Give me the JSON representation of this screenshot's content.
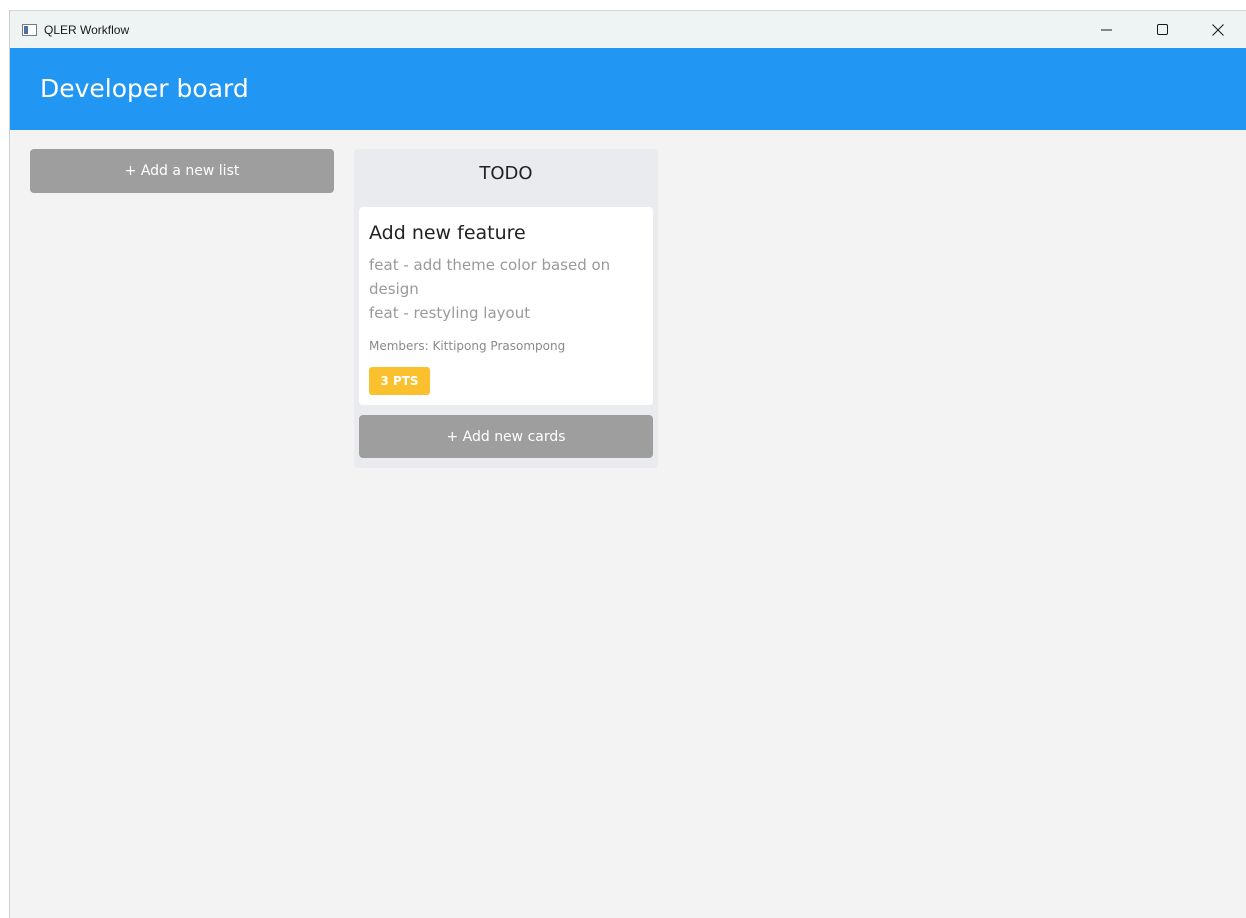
{
  "window": {
    "title": "QLER Workflow",
    "icon": "app-window-icon",
    "controls": {
      "minimize_icon": "minimize-icon",
      "maximize_icon": "maximize-icon",
      "close_icon": "close-icon"
    }
  },
  "header": {
    "title": "Developer board",
    "background_color": "#2196f3"
  },
  "board": {
    "add_list_label": "+ Add a new list",
    "lists": [
      {
        "title": "TODO",
        "cards": [
          {
            "title": "Add new feature",
            "description_lines": [
              "feat - add theme color based on design",
              "feat - restyling layout"
            ],
            "members": "Members: Kittipong Prasompong",
            "points": "3 PTS",
            "points_color": "#fbc02d"
          }
        ],
        "add_card_label": "+ Add new cards"
      }
    ]
  }
}
